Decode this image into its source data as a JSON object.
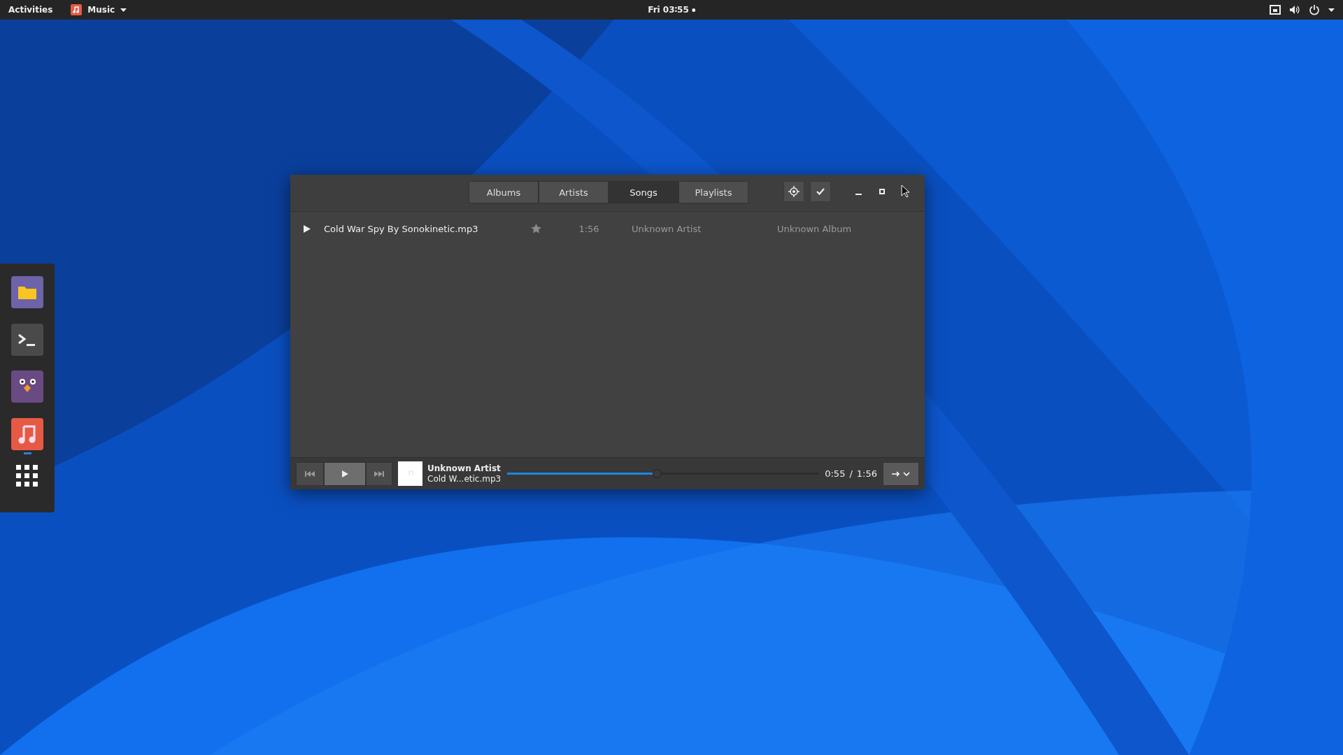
{
  "top_bar": {
    "activities": "Activities",
    "app_menu": "Music",
    "clock": "Fri 03∶55"
  },
  "dock": [
    {
      "kind": "files",
      "running": false
    },
    {
      "kind": "terminal",
      "running": false
    },
    {
      "kind": "bird",
      "running": false
    },
    {
      "kind": "music",
      "running": true
    },
    {
      "kind": "apps",
      "running": false
    }
  ],
  "window": {
    "tabs": [
      {
        "label": "Albums",
        "selected": false
      },
      {
        "label": "Artists",
        "selected": false
      },
      {
        "label": "Songs",
        "selected": true
      },
      {
        "label": "Playlists",
        "selected": false
      }
    ],
    "songs": [
      {
        "playing": true,
        "title": "Cold War Spy By Sonokinetic.mp3",
        "starred": false,
        "duration": "1:56",
        "artist": "Unknown Artist",
        "album": "Unknown Album"
      }
    ],
    "player": {
      "artist": "Unknown Artist",
      "title": "Cold W...etic.mp3",
      "level": 0.48,
      "elapsed": "0:55",
      "separator": "/",
      "total": "1:56",
      "playing": false
    }
  }
}
